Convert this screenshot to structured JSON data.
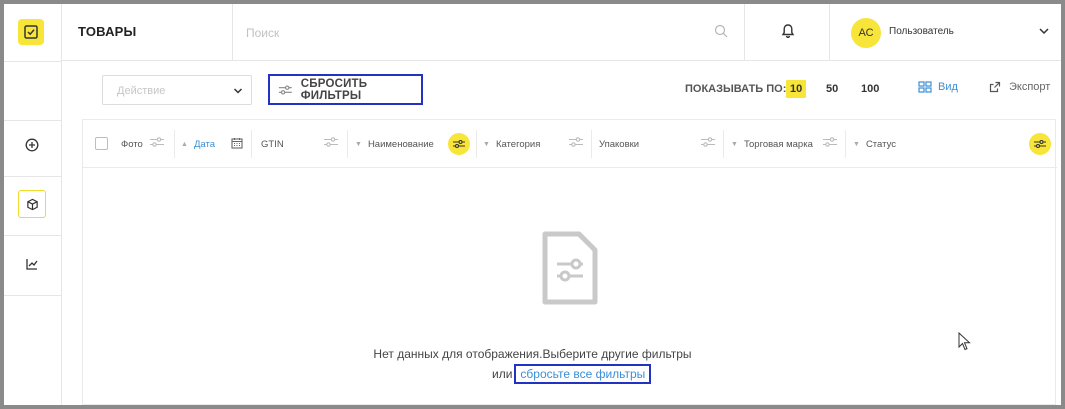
{
  "page": {
    "title": "ТОВАРЫ"
  },
  "search": {
    "placeholder": "Поиск"
  },
  "user": {
    "initials": "АС",
    "name": "Пользователь"
  },
  "toolbar": {
    "action_placeholder": "Действие",
    "reset_filters_label": "СБРОСИТЬ ФИЛЬТРЫ",
    "show_by_label": "ПОКАЗЫВАТЬ ПО:",
    "page_size_options": [
      "10",
      "50",
      "100"
    ],
    "page_size_selected": "10",
    "view_label": "Вид",
    "export_label": "Экспорт"
  },
  "table": {
    "columns": [
      {
        "label": "Фото"
      },
      {
        "label": "Дата"
      },
      {
        "label": "GTIN"
      },
      {
        "label": "Наименование"
      },
      {
        "label": "Категория"
      },
      {
        "label": "Упаковки"
      },
      {
        "label": "Торговая марка"
      },
      {
        "label": "Статус"
      }
    ],
    "empty_message_line1": "Нет данных для отображения.Выберите другие фильтры",
    "empty_message_prefix": "или",
    "empty_reset_link": "сбросьте все фильтры"
  },
  "colors": {
    "accent": "#f7e539",
    "link": "#3a8fd6",
    "highlight_box": "#2233c4"
  },
  "icons": {
    "sidebar": [
      "add-circle-icon",
      "box-icon",
      "chart-icon"
    ],
    "logo": "checklist-logo-icon"
  }
}
